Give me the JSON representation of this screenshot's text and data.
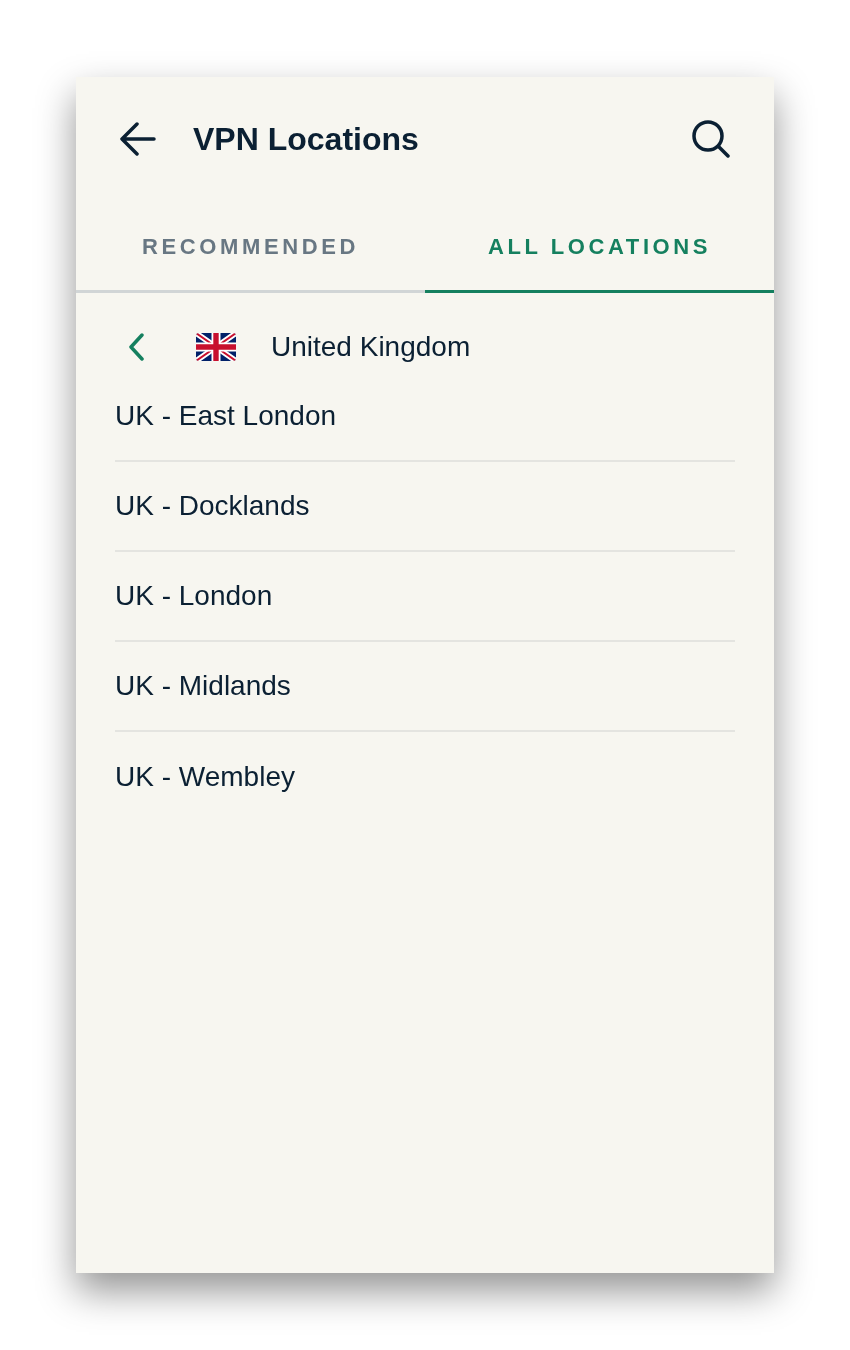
{
  "header": {
    "title": "VPN Locations"
  },
  "tabs": [
    {
      "label": "RECOMMENDED",
      "selected": false
    },
    {
      "label": "ALL LOCATIONS",
      "selected": true
    }
  ],
  "country": {
    "name": "United Kingdom"
  },
  "locations": [
    "UK - East London",
    "UK - Docklands",
    "UK - London",
    "UK - Midlands",
    "UK - Wembley"
  ]
}
